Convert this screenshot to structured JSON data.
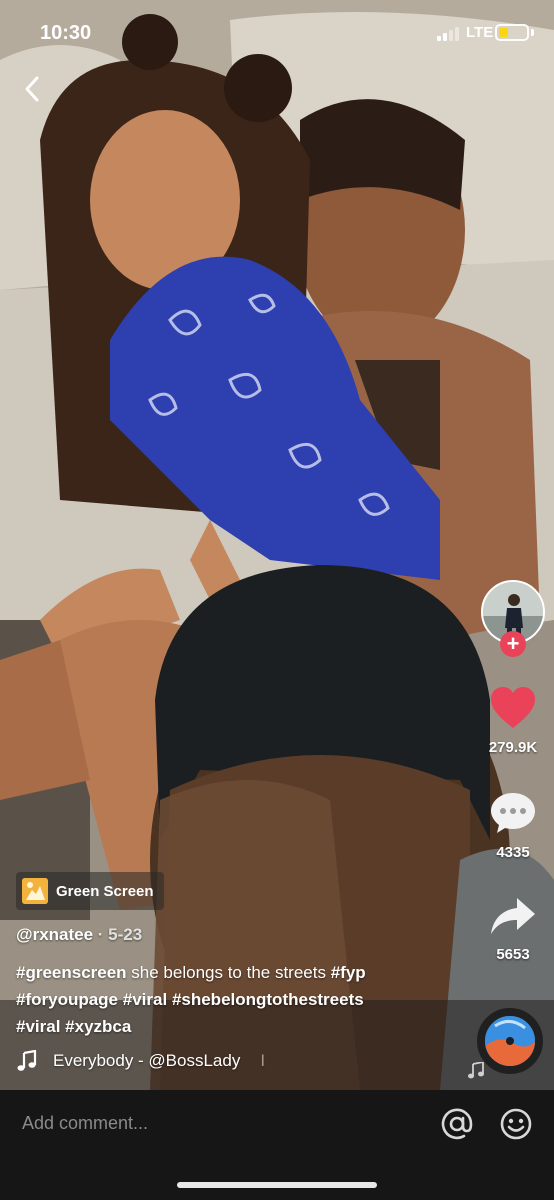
{
  "status_bar": {
    "time": "10:30",
    "network": "LTE",
    "battery_level": 0.35
  },
  "colors": {
    "accent_red": "#ea4359",
    "battery_yellow": "#ffd60a",
    "comment_bar_bg": "#161616"
  },
  "rail": {
    "likes_count": "279.9K",
    "comments_count": "4335",
    "shares_count": "5653"
  },
  "effect": {
    "label": "Green Screen"
  },
  "post": {
    "username": "@rxnatee",
    "date": " · 5-23",
    "caption": {
      "tag1": "#greenscreen",
      "text1": " she belongs to the streets ",
      "tag2": "#fyp",
      "tag3": "#foryoupage",
      "tag4": "#viral",
      "tag5": "#shebelongtothestreets",
      "tag6": "#viral",
      "tag7": "#xyzbca"
    },
    "sound": {
      "text": "Everybody - @BossLady",
      "fade": "I"
    }
  },
  "comment_bar": {
    "placeholder": "Add comment..."
  },
  "icons": {
    "back": "chevron-left-icon",
    "like": "heart-icon",
    "comment": "chat-bubble-icon",
    "share": "share-arrow-icon",
    "note": "music-note-icon",
    "mention": "at-sign-icon",
    "emoji": "smiley-icon"
  }
}
